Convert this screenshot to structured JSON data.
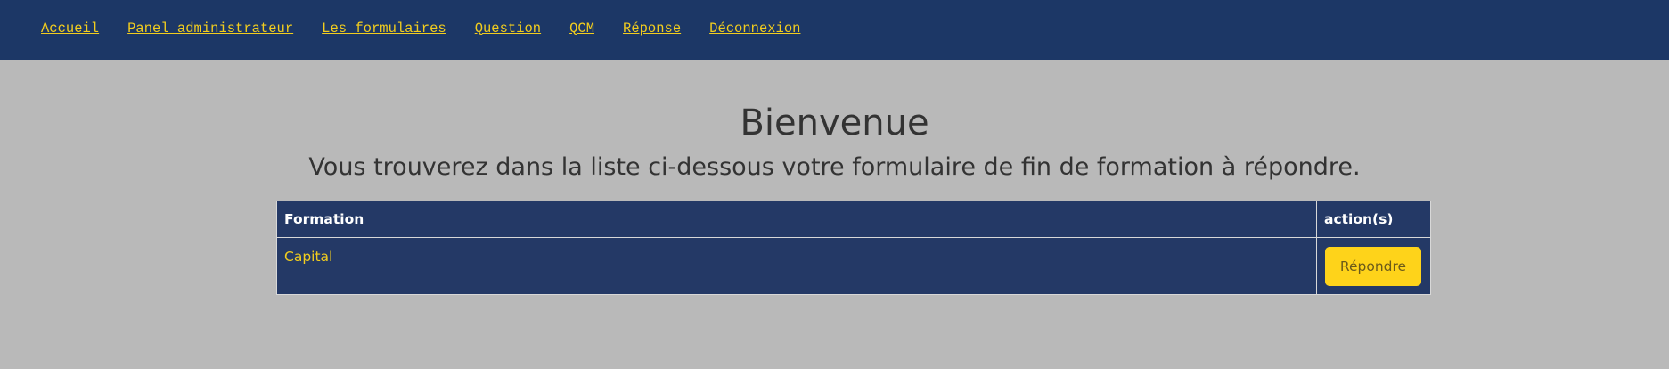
{
  "nav": {
    "items": [
      {
        "label": "Accueil"
      },
      {
        "label": "Panel administrateur"
      },
      {
        "label": "Les formulaires"
      },
      {
        "label": "Question"
      },
      {
        "label": "QCM"
      },
      {
        "label": "Réponse"
      },
      {
        "label": "Déconnexion"
      }
    ]
  },
  "main": {
    "title": "Bienvenue",
    "subtitle": "Vous trouverez dans la liste ci-dessous votre formulaire de fin de formation à répondre."
  },
  "table": {
    "headers": [
      "Formation",
      "action(s)"
    ],
    "rows": [
      {
        "formation": "Capital",
        "action": "Répondre"
      }
    ]
  },
  "colors": {
    "nav_bg": "#1c3766",
    "page_bg": "#b9b9b9",
    "table_bg": "#243966",
    "accent": "#f2cd1e",
    "button_bg": "#fed31a"
  }
}
